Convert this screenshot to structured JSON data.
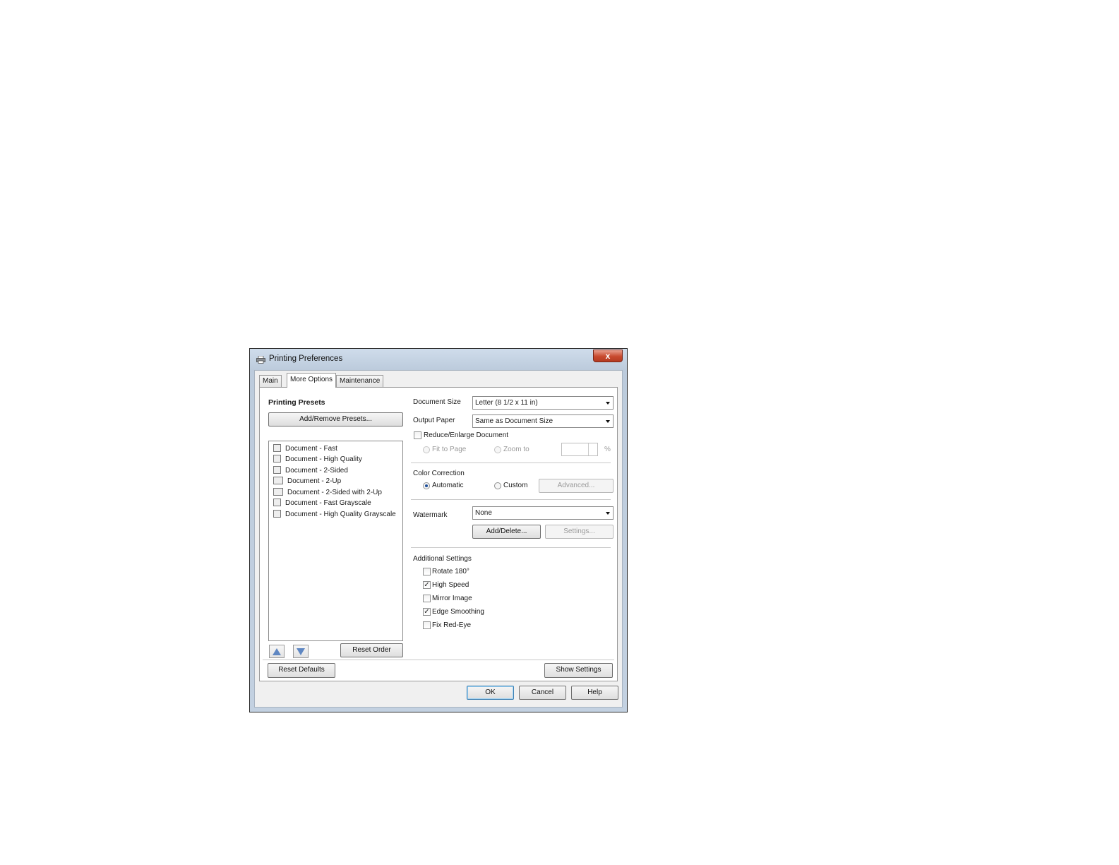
{
  "window": {
    "title": "Printing Preferences",
    "close_glyph": "x"
  },
  "tabs": [
    {
      "label": "Main"
    },
    {
      "label": "More Options"
    },
    {
      "label": "Maintenance"
    }
  ],
  "presets": {
    "heading": "Printing Presets",
    "add_remove_label": "Add/Remove Presets...",
    "items": [
      {
        "label": "Document - Fast",
        "icon": "document-fast-icon"
      },
      {
        "label": "Document - High Quality",
        "icon": "document-high-quality-icon"
      },
      {
        "label": "Document - 2-Sided",
        "icon": "document-2-sided-icon"
      },
      {
        "label": "Document - 2-Up",
        "icon": "document-2-up-icon"
      },
      {
        "label": "Document - 2-Sided with 2-Up",
        "icon": "document-2-sided-2-up-icon"
      },
      {
        "label": "Document - Fast Grayscale",
        "icon": "document-fast-grayscale-icon"
      },
      {
        "label": "Document - High Quality Grayscale",
        "icon": "document-hq-grayscale-icon"
      }
    ],
    "reset_order_label": "Reset Order"
  },
  "document": {
    "size_label": "Document Size",
    "size_value": "Letter (8 1/2 x 11 in)",
    "output_label": "Output Paper",
    "output_value": "Same as Document Size",
    "reduce_label": "Reduce/Enlarge Document",
    "reduce_checked": false,
    "fit_label": "Fit to Page",
    "zoom_label": "Zoom to",
    "percent": "%"
  },
  "color": {
    "heading": "Color Correction",
    "automatic_label": "Automatic",
    "custom_label": "Custom",
    "selected": "Automatic",
    "advanced_label": "Advanced..."
  },
  "watermark": {
    "label": "Watermark",
    "value": "None",
    "add_delete_label": "Add/Delete...",
    "settings_label": "Settings..."
  },
  "additional": {
    "heading": "Additional Settings",
    "options": [
      {
        "label": "Rotate 180°",
        "checked": false
      },
      {
        "label": "High Speed",
        "checked": true
      },
      {
        "label": "Mirror Image",
        "checked": false
      },
      {
        "label": "Edge Smoothing",
        "checked": true
      },
      {
        "label": "Fix Red-Eye",
        "checked": false
      }
    ]
  },
  "footer": {
    "reset_defaults_label": "Reset Defaults",
    "show_settings_label": "Show Settings",
    "ok_label": "OK",
    "cancel_label": "Cancel",
    "help_label": "Help"
  },
  "check_glyph": "✓"
}
